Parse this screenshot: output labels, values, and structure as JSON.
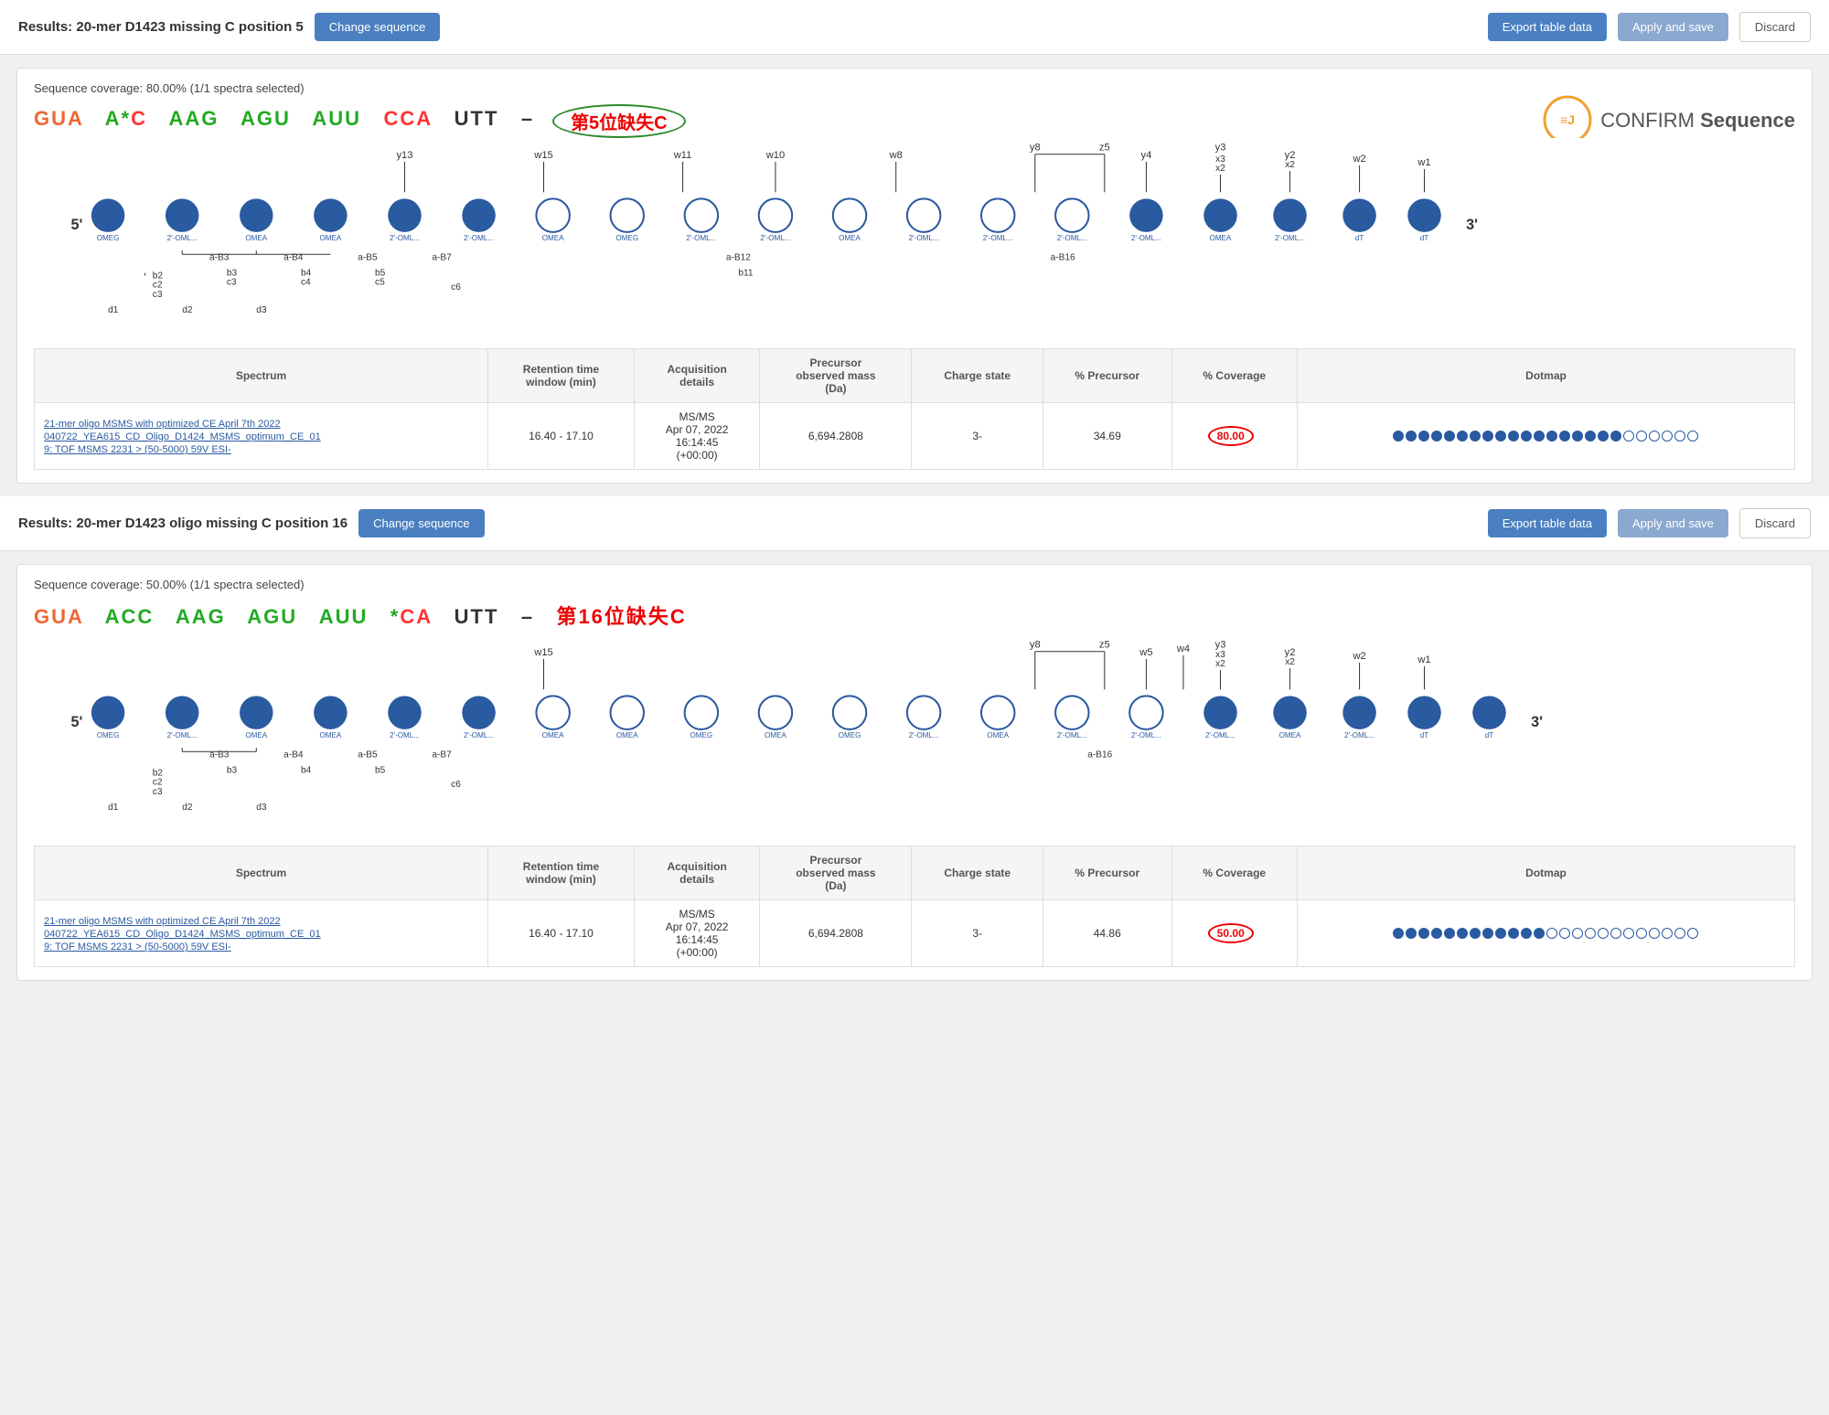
{
  "results1": {
    "title": "Results: 20-mer D1423 missing C position 5",
    "change_btn": "Change sequence",
    "export_btn": "Export table data",
    "apply_btn": "Apply and save",
    "discard_btn": "Discard",
    "coverage_text": "Sequence coverage: 80.00% (1/1 spectra selected)",
    "sequence": {
      "gua": "GUA",
      "astar": "A*",
      "c": "C",
      "aag": "AAG",
      "agu": "AGU",
      "auu": "AUU",
      "cca": "CCA",
      "utt": "UTT",
      "dash": "–",
      "annotation": "第5位缺失C"
    },
    "logo_text": "CONFIRM",
    "logo_suffix": "Sequence",
    "nucleotides": [
      {
        "label": "OMEG",
        "filled": true
      },
      {
        "label": "2'-OML...",
        "filled": true
      },
      {
        "label": "OMEA",
        "filled": true
      },
      {
        "label": "OMEA",
        "filled": true
      },
      {
        "label": "2'-OML...",
        "filled": true
      },
      {
        "label": "2'-OML...",
        "filled": true
      },
      {
        "label": "OMEA",
        "filled": false
      },
      {
        "label": "OMEG",
        "filled": false
      },
      {
        "label": "2'-OML...",
        "filled": false
      },
      {
        "label": "2'-OML...",
        "filled": false
      },
      {
        "label": "OMEA",
        "filled": false
      },
      {
        "label": "2'-OML...",
        "filled": false
      },
      {
        "label": "2'-OML...",
        "filled": false
      },
      {
        "label": "2'-OML...",
        "filled": false
      },
      {
        "label": "2'-OML...",
        "filled": true
      },
      {
        "label": "OMEA",
        "filled": true
      },
      {
        "label": "2'-OML...",
        "filled": true
      },
      {
        "label": "dT",
        "filled": true
      },
      {
        "label": "dT",
        "filled": true
      }
    ],
    "table": {
      "headers": [
        "Spectrum",
        "Retention time\nwindow (min)",
        "Acquisition\ndetails",
        "Precursor\nobserved mass\n(Da)",
        "Charge state",
        "% Precursor",
        "% Coverage",
        "Dotmap"
      ],
      "row": {
        "spectrum_link": "21-mer oligo MSMS with optimized CE April 7th 2022\n040722_YEA615_CD_Oligo_D1424_MSMS_optimum_CE_01\n9: TOF MSMS 2231 > (50-5000) 59V ESI-",
        "retention": "16.40 - 17.10",
        "acquisition": "MS/MS\nApr 07, 2022\n16:14:45\n(+00:00)",
        "precursor_mass": "6,694.2808",
        "charge_state": "3-",
        "pct_precursor": "34.69",
        "pct_coverage": "80.00",
        "dotmap_filled": 18,
        "dotmap_empty": 6
      }
    }
  },
  "results2": {
    "title": "Results: 20-mer D1423 oligo missing C position 16",
    "change_btn": "Change sequence",
    "export_btn": "Export table data",
    "apply_btn": "Apply and save",
    "discard_btn": "Discard",
    "coverage_text": "Sequence coverage: 50.00% (1/1 spectra selected)",
    "sequence": {
      "gua": "GUA",
      "acc": "ACC",
      "aag": "AAG",
      "agu": "AGU",
      "auu": "AUU",
      "star": "*",
      "ca": "CA",
      "utt": "UTT",
      "dash": "–",
      "annotation": "第16位缺失C"
    },
    "nucleotides": [
      {
        "label": "OMEG",
        "filled": true
      },
      {
        "label": "2'-OML...",
        "filled": true
      },
      {
        "label": "OMEA",
        "filled": true
      },
      {
        "label": "OMEA",
        "filled": true
      },
      {
        "label": "2'-OML...",
        "filled": true
      },
      {
        "label": "2'-OML...",
        "filled": true
      },
      {
        "label": "OMEA",
        "filled": false
      },
      {
        "label": "OMEA",
        "filled": false
      },
      {
        "label": "OMEG",
        "filled": false
      },
      {
        "label": "OMEA",
        "filled": false
      },
      {
        "label": "OMEG",
        "filled": false
      },
      {
        "label": "2'-OML...",
        "filled": false
      },
      {
        "label": "OMEA",
        "filled": false
      },
      {
        "label": "2'-OML...",
        "filled": false
      },
      {
        "label": "2'-OML...",
        "filled": false
      },
      {
        "label": "2'-OML...",
        "filled": true
      },
      {
        "label": "OMEA",
        "filled": true
      },
      {
        "label": "2'-OML...",
        "filled": true
      },
      {
        "label": "dT",
        "filled": true
      },
      {
        "label": "dT",
        "filled": true
      }
    ],
    "table": {
      "headers": [
        "Spectrum",
        "Retention time\nwindow (min)",
        "Acquisition\ndetails",
        "Precursor\nobserved mass\n(Da)",
        "Charge state",
        "% Precursor",
        "% Coverage",
        "Dotmap"
      ],
      "row": {
        "spectrum_link": "21-mer oligo MSMS with optimized CE April 7th 2022\n040722_YEA615_CD_Oligo_D1424_MSMS_optimum_CE_01\n9: TOF MSMS 2231 > (50-5000) 59V ESI-",
        "retention": "16.40 - 17.10",
        "acquisition": "MS/MS\nApr 07, 2022\n16:14:45\n(+00:00)",
        "precursor_mass": "6,694.2808",
        "charge_state": "3-",
        "pct_precursor": "44.86",
        "pct_coverage": "50.00",
        "dotmap_filled": 12,
        "dotmap_empty": 12
      }
    }
  }
}
